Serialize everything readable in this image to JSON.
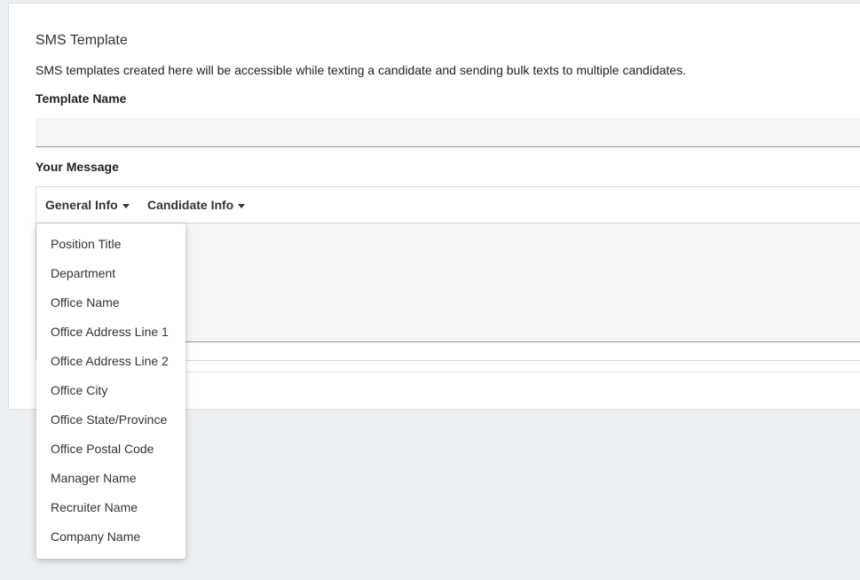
{
  "form": {
    "title": "SMS Template",
    "description": "SMS templates created here will be accessible while texting a candidate and sending bulk texts to multiple candidates.",
    "template_name_label": "Template Name",
    "template_name_value": "",
    "message_label": "Your Message"
  },
  "toolbar": {
    "general_info": "General Info",
    "candidate_info": "Candidate Info"
  },
  "general_info_menu": {
    "items": [
      {
        "label": "Position Title"
      },
      {
        "label": "Department"
      },
      {
        "label": "Office Name"
      },
      {
        "label": "Office Address Line 1"
      },
      {
        "label": "Office Address Line 2"
      },
      {
        "label": "Office City"
      },
      {
        "label": "Office State/Province"
      },
      {
        "label": "Office Postal Code"
      },
      {
        "label": "Manager Name"
      },
      {
        "label": "Recruiter Name"
      },
      {
        "label": "Company Name"
      }
    ]
  },
  "colors": {
    "page_background": "#ebeff2",
    "panel_background": "#ffffff",
    "input_background": "#f5f5f5"
  },
  "icons": {
    "dropdown_caret": "caret-down-icon"
  }
}
